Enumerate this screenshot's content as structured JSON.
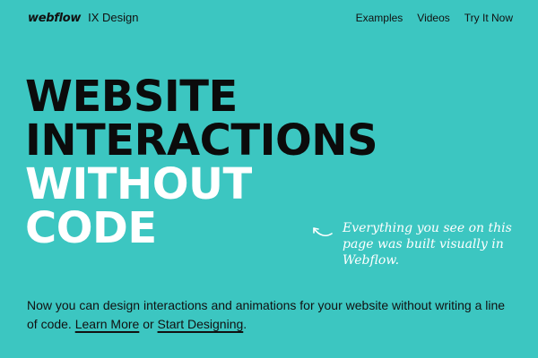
{
  "nav": {
    "logo": "webflow",
    "product": "IX Design",
    "links": [
      "Examples",
      "Videos",
      "Try It Now"
    ]
  },
  "hero": {
    "line1": "WEBSITE",
    "line2": "INTERACTIONS",
    "line3": "WITHOUT",
    "line4": "CODE"
  },
  "note": {
    "text": "Everything you see on this page was built visually in Webflow."
  },
  "lead": {
    "text": "Now you can design interactions and animations for your website without writing a line of code.",
    "link1": "Learn More",
    "connector": "or",
    "link2": "Start Designing",
    "end": "."
  },
  "colors": {
    "background": "#3cc6c1",
    "dark_text": "#0b0b0b",
    "light_text": "#ffffff"
  }
}
